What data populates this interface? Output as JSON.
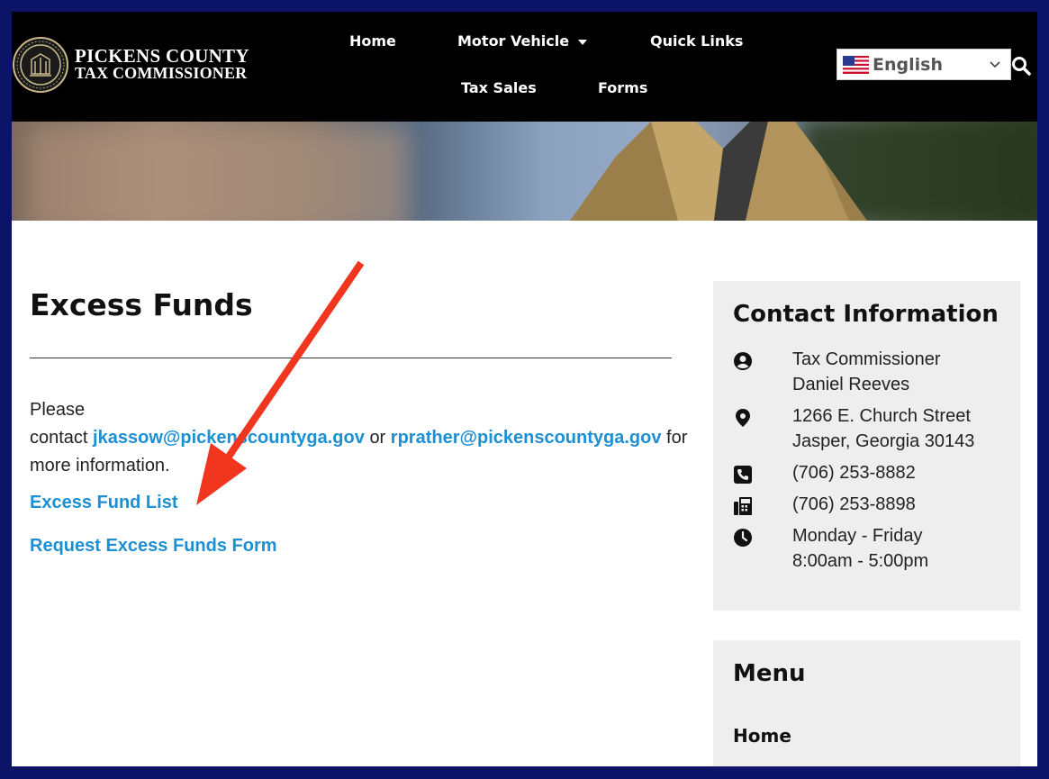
{
  "header": {
    "logo_line1": "PICKENS COUNTY",
    "logo_line2": "TAX COMMISSIONER",
    "nav": {
      "home": "Home",
      "motor_vehicle": "Motor Vehicle",
      "quick_links": "Quick Links",
      "tax_sales": "Tax Sales",
      "forms": "Forms"
    },
    "language": "English"
  },
  "main": {
    "title": "Excess Funds",
    "text_please": "Please",
    "text_contact": "contact",
    "email1": "jkassow@pickenscountyga.gov",
    "text_or": "or",
    "email2": "rprather@pickenscountyga.gov",
    "text_for": "for",
    "text_more": "more information.",
    "link_list": "Excess Fund List",
    "link_form": "Request Excess Funds Form"
  },
  "sidebar": {
    "contact_title": "Contact Information",
    "person_line1": "Tax Commissioner",
    "person_line2": "Daniel Reeves",
    "address_line1": "1266 E. Church Street",
    "address_line2": "Jasper, Georgia 30143",
    "phone": "(706) 253-8882",
    "fax": "(706) 253-8898",
    "hours_line1": "Monday - Friday",
    "hours_line2": "8:00am - 5:00pm",
    "menu_title": "Menu",
    "menu_home": "Home"
  },
  "colors": {
    "border": "#0b1466",
    "link": "#1d8fd3",
    "annotation_arrow": "#f0361f"
  }
}
